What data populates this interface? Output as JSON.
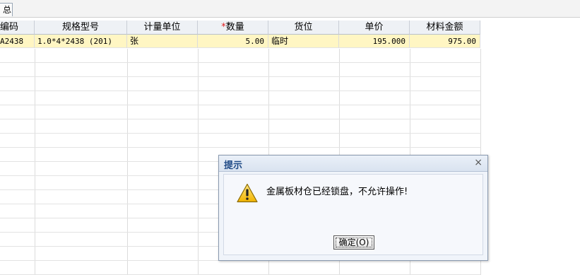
{
  "topbar": {
    "tab_label": "总"
  },
  "table": {
    "headers": [
      {
        "label": "编码",
        "required": false
      },
      {
        "label": "规格型号",
        "required": false
      },
      {
        "label": "计量单位",
        "required": false
      },
      {
        "label": "数量",
        "required": true
      },
      {
        "label": "货位",
        "required": false
      },
      {
        "label": "单价",
        "required": false
      },
      {
        "label": "材料金额",
        "required": false
      }
    ],
    "rows": [
      {
        "code": "A2438",
        "spec": "1.0*4*2438 (201)",
        "unit": "张",
        "qty": "5.00",
        "location": "临时",
        "price": "195.000",
        "amount": "975.00"
      }
    ],
    "required_mark": "*",
    "selected_row_color": "#fff6c3"
  },
  "dialog": {
    "title": "提示",
    "close_glyph": "×",
    "icon": "warning-icon",
    "message": "金属板材仓已经锁盘，不允许操作!",
    "ok_label": "确定(O)"
  }
}
